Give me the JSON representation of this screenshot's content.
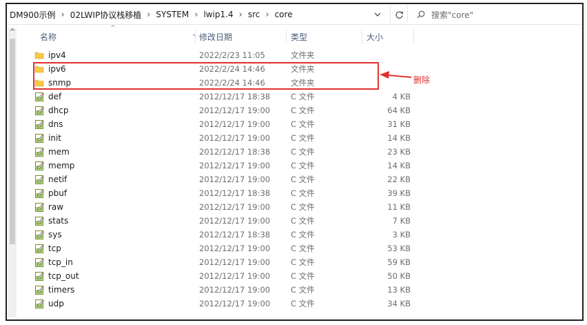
{
  "address_bar": {
    "breadcrumbs": [
      "DM900示例",
      "02LWIP协议栈移植",
      "SYSTEM",
      "lwip1.4",
      "src",
      "core"
    ]
  },
  "search": {
    "placeholder": "搜索\"core\""
  },
  "columns": {
    "name": "名称",
    "date": "修改日期",
    "type": "类型",
    "size": "大小"
  },
  "rows": [
    {
      "name": "ipv4",
      "date": "2022/2/23 11:05",
      "type": "文件夹",
      "size": "",
      "icon": "folder-icon"
    },
    {
      "name": "ipv6",
      "date": "2022/2/24 14:46",
      "type": "文件夹",
      "size": "",
      "icon": "folder-icon"
    },
    {
      "name": "snmp",
      "date": "2022/2/24 14:46",
      "type": "文件夹",
      "size": "",
      "icon": "folder-icon"
    },
    {
      "name": "def",
      "date": "2012/12/17 18:38",
      "type": "C 文件",
      "size": "4 KB",
      "icon": "c-file-icon"
    },
    {
      "name": "dhcp",
      "date": "2012/12/17 19:00",
      "type": "C 文件",
      "size": "64 KB",
      "icon": "c-file-icon"
    },
    {
      "name": "dns",
      "date": "2012/12/17 19:00",
      "type": "C 文件",
      "size": "31 KB",
      "icon": "c-file-icon"
    },
    {
      "name": "init",
      "date": "2012/12/17 19:00",
      "type": "C 文件",
      "size": "14 KB",
      "icon": "c-file-icon"
    },
    {
      "name": "mem",
      "date": "2012/12/17 18:38",
      "type": "C 文件",
      "size": "23 KB",
      "icon": "c-file-icon"
    },
    {
      "name": "memp",
      "date": "2012/12/17 19:00",
      "type": "C 文件",
      "size": "14 KB",
      "icon": "c-file-icon"
    },
    {
      "name": "netif",
      "date": "2012/12/17 19:00",
      "type": "C 文件",
      "size": "22 KB",
      "icon": "c-file-icon"
    },
    {
      "name": "pbuf",
      "date": "2012/12/17 18:38",
      "type": "C 文件",
      "size": "39 KB",
      "icon": "c-file-icon"
    },
    {
      "name": "raw",
      "date": "2012/12/17 19:00",
      "type": "C 文件",
      "size": "11 KB",
      "icon": "c-file-icon"
    },
    {
      "name": "stats",
      "date": "2012/12/17 19:00",
      "type": "C 文件",
      "size": "7 KB",
      "icon": "c-file-icon"
    },
    {
      "name": "sys",
      "date": "2012/12/17 18:38",
      "type": "C 文件",
      "size": "3 KB",
      "icon": "c-file-icon"
    },
    {
      "name": "tcp",
      "date": "2012/12/17 19:00",
      "type": "C 文件",
      "size": "53 KB",
      "icon": "c-file-icon"
    },
    {
      "name": "tcp_in",
      "date": "2012/12/17 19:00",
      "type": "C 文件",
      "size": "59 KB",
      "icon": "c-file-icon"
    },
    {
      "name": "tcp_out",
      "date": "2012/12/17 19:00",
      "type": "C 文件",
      "size": "50 KB",
      "icon": "c-file-icon"
    },
    {
      "name": "timers",
      "date": "2012/12/17 19:00",
      "type": "C 文件",
      "size": "13 KB",
      "icon": "c-file-icon"
    },
    {
      "name": "udp",
      "date": "2012/12/17 19:00",
      "type": "C 文件",
      "size": "34 KB",
      "icon": "c-file-icon"
    }
  ],
  "annotation": {
    "label": "删除",
    "color": "#e03030"
  },
  "colors": {
    "folder": "#f5c74b",
    "header_text": "#4b5c7a",
    "annotation": "#e03030"
  }
}
